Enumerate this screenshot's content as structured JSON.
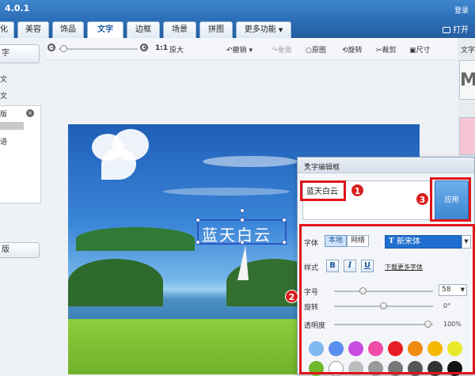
{
  "app": {
    "version": "4.0.1",
    "login": "登录",
    "open": "打开"
  },
  "tabs": [
    {
      "label": "化",
      "active": false
    },
    {
      "label": "美容",
      "active": false
    },
    {
      "label": "饰品",
      "active": false
    },
    {
      "label": "文字",
      "active": true
    },
    {
      "label": "边框",
      "active": false
    },
    {
      "label": "场景",
      "active": false
    },
    {
      "label": "拼图",
      "active": false
    },
    {
      "label": "更多功能",
      "active": false
    }
  ],
  "toolbar": {
    "zoom_level_label": "1:1",
    "original_size": "原大",
    "undo": "撤销",
    "redo": "重做",
    "original": "原图",
    "rotate": "旋转",
    "crop": "裁剪",
    "size": "尺寸"
  },
  "left_panel": {
    "top_button": "字",
    "line1": "文",
    "line2": "文",
    "box_title": "版",
    "box_item": "语",
    "bottom_button": "版"
  },
  "right_panel": {
    "label": "文字",
    "thumb_letter": "M"
  },
  "canvas": {
    "overlay_text": "蓝天白云"
  },
  "dialog": {
    "title": "文字编辑框",
    "input_text": "蓝天白云",
    "apply": "应用",
    "font_label": "字体",
    "font_local": "本地",
    "font_web": "网络",
    "font_name": "新宋体",
    "style_label": "样式",
    "bold": "B",
    "italic": "I",
    "underline": "U",
    "download_link": "下载更多字体",
    "size_label": "字号",
    "size_value": "58",
    "size_slider": 0.28,
    "rotate_label": "旋转",
    "rotate_value": "0°",
    "rotate_slider": 0.5,
    "opacity_label": "透明度",
    "opacity_value": "100%",
    "opacity_slider": 0.98
  },
  "markers": [
    "1",
    "2",
    "3"
  ],
  "colors": {
    "accent": "#2d6fb8",
    "marker": "#d81e1e",
    "swatches_row1": [
      "#7fb7f0",
      "#5a8ff0",
      "#c84de0",
      "#f04ea8",
      "#e81c24",
      "#f08a10",
      "#f5b800",
      "#e8e82a"
    ],
    "swatches_row2": [
      "#6cb82a",
      "#ffffff",
      "#bdbdbd",
      "#999999",
      "#777777",
      "#555555",
      "#333333",
      "#111111"
    ]
  }
}
